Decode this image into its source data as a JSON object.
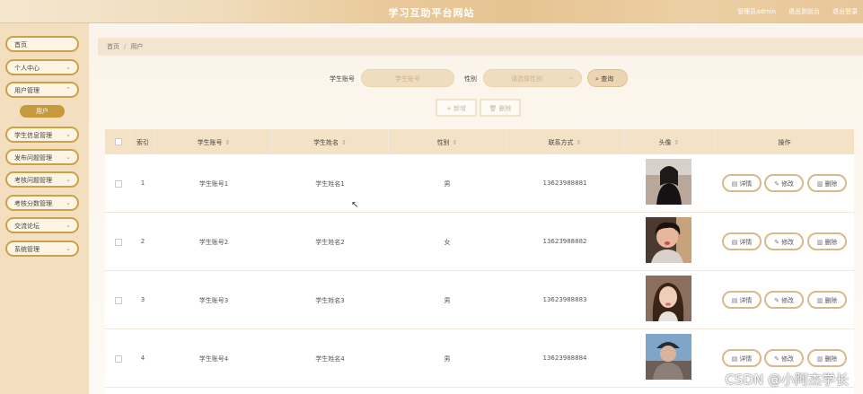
{
  "header": {
    "title": "学习互助平台网站",
    "links": [
      "管理员admin",
      "退出到前台",
      "退出登录"
    ]
  },
  "sidebar": {
    "items": [
      {
        "label": "首页",
        "expandable": false
      },
      {
        "label": "个人中心",
        "expandable": true
      },
      {
        "label": "用户管理",
        "expandable": true
      },
      {
        "label": "学生信息管理",
        "expandable": true
      },
      {
        "label": "发布问题管理",
        "expandable": true
      },
      {
        "label": "考核问题管理",
        "expandable": true
      },
      {
        "label": "考核分数管理",
        "expandable": true
      },
      {
        "label": "交流论坛",
        "expandable": true
      },
      {
        "label": "系统管理",
        "expandable": true
      }
    ],
    "active_sub": "用户"
  },
  "breadcrumb": {
    "home": "首页",
    "separator": "/",
    "current": "用户"
  },
  "search": {
    "account_label": "学生账号",
    "account_placeholder": "学生账号",
    "gender_label": "性别",
    "gender_placeholder": "请选择性别",
    "button_label": "查询",
    "button_icon": "search-icon"
  },
  "toolbar": {
    "add_label": "+ 新增",
    "delete_label": "删除"
  },
  "table": {
    "columns": [
      "索引",
      "学生账号",
      "学生姓名",
      "性别",
      "联系方式",
      "头像",
      "操作"
    ],
    "rows": [
      {
        "index": "1",
        "account": "学生账号1",
        "name": "学生姓名1",
        "gender": "男",
        "phone": "13623988881"
      },
      {
        "index": "2",
        "account": "学生账号2",
        "name": "学生姓名2",
        "gender": "女",
        "phone": "13623988882"
      },
      {
        "index": "3",
        "account": "学生账号3",
        "name": "学生姓名3",
        "gender": "男",
        "phone": "13623988883"
      },
      {
        "index": "4",
        "account": "学生账号4",
        "name": "学生姓名4",
        "gender": "男",
        "phone": "13623988884"
      }
    ],
    "actions": {
      "detail": "详情",
      "edit": "修改",
      "delete": "删除"
    }
  },
  "watermark": "CSDN @小阿杰学长",
  "colors": {
    "accent": "#c49a3c",
    "header": "#e6c391",
    "sidebar": "#f3dfc0",
    "table_header": "#f3e2c6"
  }
}
